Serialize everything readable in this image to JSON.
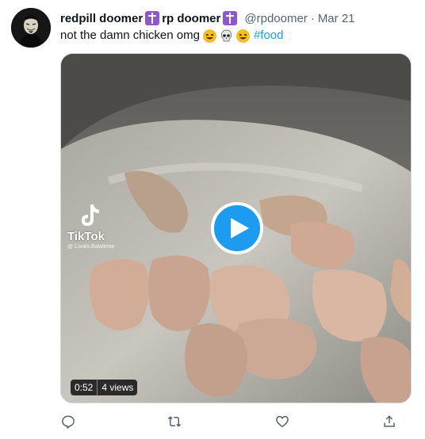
{
  "tweet": {
    "display_name_1": "redpill doomer",
    "display_name_2": "rp doomer",
    "handle": "@rpdoomer",
    "separator": "·",
    "date": "Mar 21",
    "text": "not the damn chicken omg",
    "emojis": [
      "grinning-squint-emoji",
      "skull-emoji",
      "grinning-squint-emoji"
    ],
    "hashtag": "#food",
    "badge_icon": "orthodox-cross-icon",
    "badge_color": "#8e57c9"
  },
  "media": {
    "type": "video",
    "watermark": "TikTok",
    "watermark_user": "@ Lorals.Balaleme",
    "duration": "0:52",
    "views": "4 views",
    "play_color": "#1d9bf0"
  },
  "actions": [
    "reply-icon",
    "retweet-icon",
    "like-icon",
    "share-icon"
  ]
}
